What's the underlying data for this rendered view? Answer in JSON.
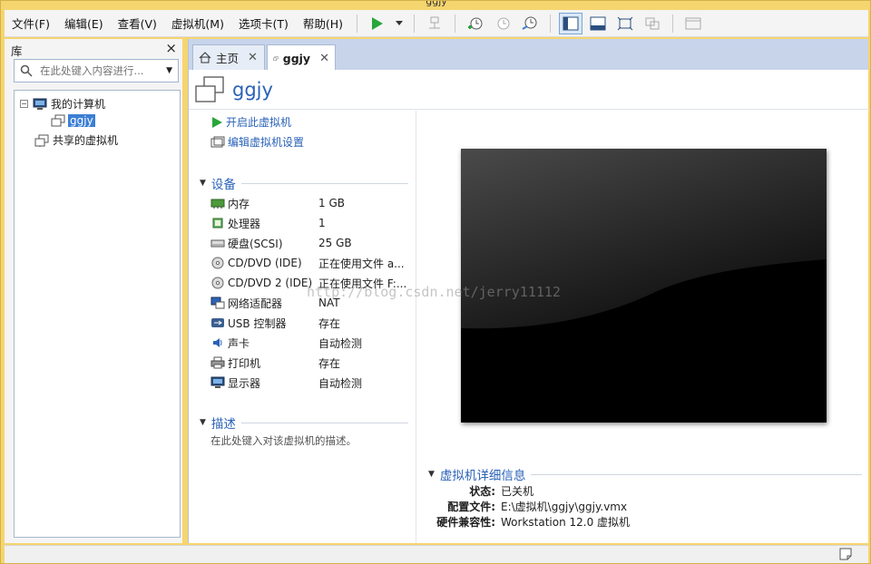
{
  "window": {
    "title": "ggjy"
  },
  "menu": {
    "items": [
      "文件(F)",
      "编辑(E)",
      "查看(V)",
      "虚拟机(M)",
      "选项卡(T)",
      "帮助(H)"
    ]
  },
  "library": {
    "title": "库",
    "close": "×",
    "search_placeholder": "在此处键入内容进行...",
    "tree": {
      "my_computer": "我的计算机",
      "vm_selected": "ggjy",
      "shared_vms": "共享的虚拟机"
    }
  },
  "tabs": [
    {
      "label": "主页"
    },
    {
      "label": "ggjy"
    }
  ],
  "vm": {
    "name": "ggjy",
    "actions": {
      "power_on": "开启此虚拟机",
      "edit_settings": "编辑虚拟机设置"
    },
    "devices_section": "设备",
    "devices": [
      {
        "name": "内存",
        "value": "1 GB",
        "icon": "memory-icon"
      },
      {
        "name": "处理器",
        "value": "1",
        "icon": "processor-icon"
      },
      {
        "name": "硬盘(SCSI)",
        "value": "25 GB",
        "icon": "hard-disk-icon"
      },
      {
        "name": "CD/DVD (IDE)",
        "value": "正在使用文件 a...",
        "icon": "cd-dvd-icon"
      },
      {
        "name": "CD/DVD 2 (IDE)",
        "value": "正在使用文件 F:...",
        "icon": "cd-dvd-icon"
      },
      {
        "name": "网络适配器",
        "value": "NAT",
        "icon": "network-adapter-icon"
      },
      {
        "name": "USB 控制器",
        "value": "存在",
        "icon": "usb-icon"
      },
      {
        "name": "声卡",
        "value": "自动检测",
        "icon": "sound-icon"
      },
      {
        "name": "打印机",
        "value": "存在",
        "icon": "printer-icon"
      },
      {
        "name": "显示器",
        "value": "自动检测",
        "icon": "display-icon"
      }
    ],
    "description_section": "描述",
    "description_placeholder": "在此处键入对该虚拟机的描述。",
    "details_section": "虚拟机详细信息",
    "details": [
      {
        "key": "状态:",
        "value": "已关机"
      },
      {
        "key": "配置文件:",
        "value": "E:\\虚拟机\\ggjy\\ggjy.vmx"
      },
      {
        "key": "硬件兼容性:",
        "value": "Workstation 12.0 虚拟机"
      }
    ]
  },
  "watermark": "http://blog.csdn.net/jerry11112",
  "colors": {
    "accent": "#2a62b8",
    "play": "#2aa63c",
    "frame": "#f5d56e",
    "tab_bg": "#c7d4ea"
  }
}
